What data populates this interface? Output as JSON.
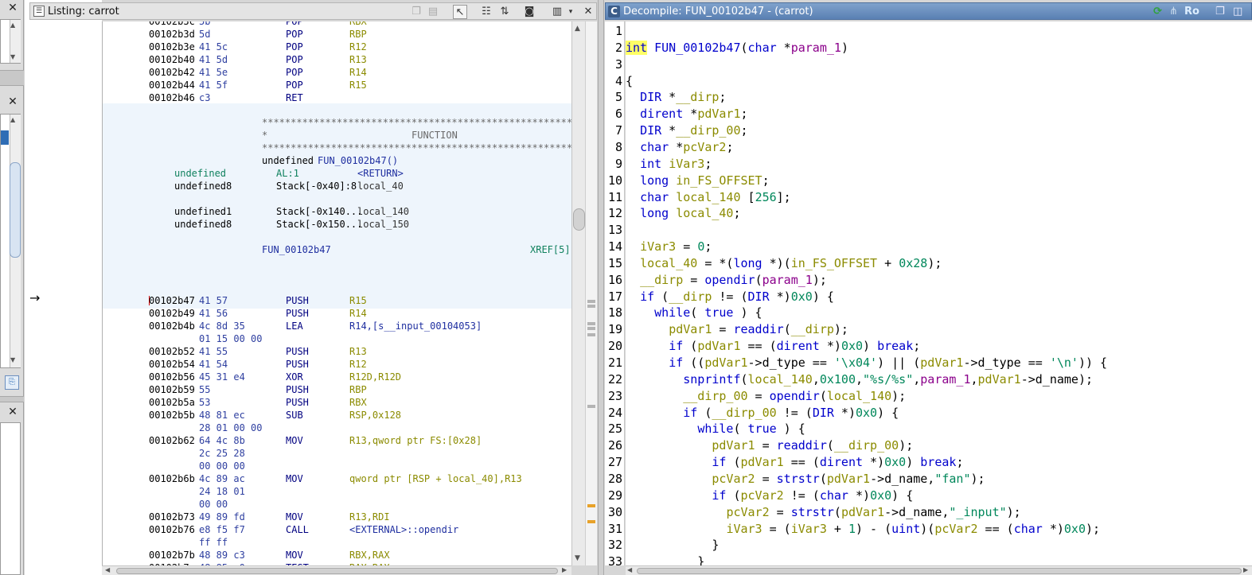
{
  "listing": {
    "title": "Listing:  carrot",
    "rows": [
      {
        "addr": "00102b3d",
        "bytes": "5d",
        "mnem": "POP",
        "oper": "RBP"
      },
      {
        "addr": "00102b3e",
        "bytes": "41 5c",
        "mnem": "POP",
        "oper": "R12"
      },
      {
        "addr": "00102b40",
        "bytes": "41 5d",
        "mnem": "POP",
        "oper": "R13"
      },
      {
        "addr": "00102b42",
        "bytes": "41 5e",
        "mnem": "POP",
        "oper": "R14"
      },
      {
        "addr": "00102b44",
        "bytes": "41 5f",
        "mnem": "POP",
        "oper": "R15"
      },
      {
        "addr": "00102b46",
        "bytes": "c3",
        "mnem": "RET",
        "oper": ""
      }
    ],
    "function_header": {
      "stars": "************************************************************",
      "star_mid": "*",
      "title": "FUNCTION",
      "signature_type": "undefined",
      "signature_name": "FUN_00102b47()",
      "vars": [
        {
          "type": "undefined",
          "loc": "AL:1",
          "name": "<RETURN>"
        },
        {
          "type": "undefined8",
          "loc": "Stack[-0x40]:8",
          "name": "local_40"
        },
        {
          "type": "undefined1",
          "loc": "Stack[-0x140...",
          "name": "local_140"
        },
        {
          "type": "undefined8",
          "loc": "Stack[-0x150...",
          "name": "local_150"
        }
      ],
      "label": "FUN_00102b47",
      "xref": "XREF[5]"
    },
    "code": [
      {
        "addr": "00102b47",
        "bytes": "41 57",
        "mnem": "PUSH",
        "oper": "R15"
      },
      {
        "addr": "00102b49",
        "bytes": "41 56",
        "mnem": "PUSH",
        "oper": "R14"
      },
      {
        "addr": "00102b4b",
        "bytes": "4c 8d 35",
        "mnem": "LEA",
        "oper": "R14,[s__input_00104053]"
      },
      {
        "addr": "",
        "bytes": "01 15 00 00",
        "mnem": "",
        "oper": ""
      },
      {
        "addr": "00102b52",
        "bytes": "41 55",
        "mnem": "PUSH",
        "oper": "R13"
      },
      {
        "addr": "00102b54",
        "bytes": "41 54",
        "mnem": "PUSH",
        "oper": "R12"
      },
      {
        "addr": "00102b56",
        "bytes": "45 31 e4",
        "mnem": "XOR",
        "oper": "R12D,R12D"
      },
      {
        "addr": "00102b59",
        "bytes": "55",
        "mnem": "PUSH",
        "oper": "RBP"
      },
      {
        "addr": "00102b5a",
        "bytes": "53",
        "mnem": "PUSH",
        "oper": "RBX"
      },
      {
        "addr": "00102b5b",
        "bytes": "48 81 ec",
        "mnem": "SUB",
        "oper": "RSP,0x128"
      },
      {
        "addr": "",
        "bytes": "28 01 00 00",
        "mnem": "",
        "oper": ""
      },
      {
        "addr": "00102b62",
        "bytes": "64 4c 8b",
        "mnem": "MOV",
        "oper": "R13,qword ptr FS:[0x28]"
      },
      {
        "addr": "",
        "bytes": "2c 25 28",
        "mnem": "",
        "oper": ""
      },
      {
        "addr": "",
        "bytes": "00 00 00",
        "mnem": "",
        "oper": ""
      },
      {
        "addr": "00102b6b",
        "bytes": "4c 89 ac",
        "mnem": "MOV",
        "oper": "qword ptr [RSP + local_40],R13"
      },
      {
        "addr": "",
        "bytes": "24 18 01",
        "mnem": "",
        "oper": ""
      },
      {
        "addr": "",
        "bytes": "00 00",
        "mnem": "",
        "oper": ""
      },
      {
        "addr": "00102b73",
        "bytes": "49 89 fd",
        "mnem": "MOV",
        "oper": "R13,RDI"
      },
      {
        "addr": "00102b76",
        "bytes": "e8 f5 f7",
        "mnem": "CALL",
        "oper": "<EXTERNAL>::opendir"
      },
      {
        "addr": "",
        "bytes": "ff ff",
        "mnem": "",
        "oper": ""
      },
      {
        "addr": "00102b7b",
        "bytes": "48 89 c3",
        "mnem": "MOV",
        "oper": "RBX,RAX"
      }
    ]
  },
  "decompile": {
    "title": "Decompile: FUN_00102b47 - (carrot)",
    "ro_label": "Ro",
    "lines": [
      "1",
      "2",
      "3",
      "4",
      "5",
      "6",
      "7",
      "8",
      "9",
      "10",
      "11",
      "12",
      "13",
      "14",
      "15",
      "16",
      "17",
      "18",
      "19",
      "20",
      "21",
      "22",
      "23",
      "24",
      "25",
      "26",
      "27",
      "28",
      "29",
      "30",
      "31",
      "32",
      "33"
    ],
    "code": [
      [],
      [
        [
          "type",
          "int"
        ],
        [
          "plain",
          " "
        ],
        [
          "fn",
          "FUN_00102b47"
        ],
        [
          "plain",
          "("
        ],
        [
          "type",
          "char"
        ],
        [
          "plain",
          " *"
        ],
        [
          "param",
          "param_1"
        ],
        [
          "plain",
          ")"
        ]
      ],
      [],
      [
        [
          "plain",
          "{"
        ]
      ],
      [
        [
          "plain",
          "  "
        ],
        [
          "type",
          "DIR"
        ],
        [
          "plain",
          " *"
        ],
        [
          "var",
          "__dirp"
        ],
        [
          "plain",
          ";"
        ]
      ],
      [
        [
          "plain",
          "  "
        ],
        [
          "type",
          "dirent"
        ],
        [
          "plain",
          " *"
        ],
        [
          "var",
          "pdVar1"
        ],
        [
          "plain",
          ";"
        ]
      ],
      [
        [
          "plain",
          "  "
        ],
        [
          "type",
          "DIR"
        ],
        [
          "plain",
          " *"
        ],
        [
          "var",
          "__dirp_00"
        ],
        [
          "plain",
          ";"
        ]
      ],
      [
        [
          "plain",
          "  "
        ],
        [
          "type",
          "char"
        ],
        [
          "plain",
          " *"
        ],
        [
          "var",
          "pcVar2"
        ],
        [
          "plain",
          ";"
        ]
      ],
      [
        [
          "plain",
          "  "
        ],
        [
          "type",
          "int"
        ],
        [
          "plain",
          " "
        ],
        [
          "var",
          "iVar3"
        ],
        [
          "plain",
          ";"
        ]
      ],
      [
        [
          "plain",
          "  "
        ],
        [
          "type",
          "long"
        ],
        [
          "plain",
          " "
        ],
        [
          "var",
          "in_FS_OFFSET"
        ],
        [
          "plain",
          ";"
        ]
      ],
      [
        [
          "plain",
          "  "
        ],
        [
          "type",
          "char"
        ],
        [
          "plain",
          " "
        ],
        [
          "var",
          "local_140"
        ],
        [
          "plain",
          " ["
        ],
        [
          "num",
          "256"
        ],
        [
          "plain",
          "];"
        ]
      ],
      [
        [
          "plain",
          "  "
        ],
        [
          "type",
          "long"
        ],
        [
          "plain",
          " "
        ],
        [
          "var",
          "local_40"
        ],
        [
          "plain",
          ";"
        ]
      ],
      [],
      [
        [
          "plain",
          "  "
        ],
        [
          "var",
          "iVar3"
        ],
        [
          "plain",
          " = "
        ],
        [
          "num",
          "0"
        ],
        [
          "plain",
          ";"
        ]
      ],
      [
        [
          "plain",
          "  "
        ],
        [
          "var",
          "local_40"
        ],
        [
          "plain",
          " = *("
        ],
        [
          "type",
          "long"
        ],
        [
          "plain",
          " *)("
        ],
        [
          "var",
          "in_FS_OFFSET"
        ],
        [
          "plain",
          " + "
        ],
        [
          "num",
          "0x28"
        ],
        [
          "plain",
          ");"
        ]
      ],
      [
        [
          "plain",
          "  "
        ],
        [
          "var",
          "__dirp"
        ],
        [
          "plain",
          " = "
        ],
        [
          "fn",
          "opendir"
        ],
        [
          "plain",
          "("
        ],
        [
          "param",
          "param_1"
        ],
        [
          "plain",
          ");"
        ]
      ],
      [
        [
          "plain",
          "  "
        ],
        [
          "kw",
          "if"
        ],
        [
          "plain",
          " ("
        ],
        [
          "var",
          "__dirp"
        ],
        [
          "plain",
          " != ("
        ],
        [
          "type",
          "DIR"
        ],
        [
          "plain",
          " *)"
        ],
        [
          "num",
          "0x0"
        ],
        [
          "plain",
          ") {"
        ]
      ],
      [
        [
          "plain",
          "    "
        ],
        [
          "kw",
          "while"
        ],
        [
          "plain",
          "( "
        ],
        [
          "kw",
          "true"
        ],
        [
          "plain",
          " ) {"
        ]
      ],
      [
        [
          "plain",
          "      "
        ],
        [
          "var",
          "pdVar1"
        ],
        [
          "plain",
          " = "
        ],
        [
          "fn",
          "readdir"
        ],
        [
          "plain",
          "("
        ],
        [
          "var",
          "__dirp"
        ],
        [
          "plain",
          ");"
        ]
      ],
      [
        [
          "plain",
          "      "
        ],
        [
          "kw",
          "if"
        ],
        [
          "plain",
          " ("
        ],
        [
          "var",
          "pdVar1"
        ],
        [
          "plain",
          " == ("
        ],
        [
          "type",
          "dirent"
        ],
        [
          "plain",
          " *)"
        ],
        [
          "num",
          "0x0"
        ],
        [
          "plain",
          ") "
        ],
        [
          "kw",
          "break"
        ],
        [
          "plain",
          ";"
        ]
      ],
      [
        [
          "plain",
          "      "
        ],
        [
          "kw",
          "if"
        ],
        [
          "plain",
          " (("
        ],
        [
          "var",
          "pdVar1"
        ],
        [
          "plain",
          "->d_type == "
        ],
        [
          "str",
          "'\\x04'"
        ],
        [
          "plain",
          ") || ("
        ],
        [
          "var",
          "pdVar1"
        ],
        [
          "plain",
          "->d_type == "
        ],
        [
          "str",
          "'\\n'"
        ],
        [
          "plain",
          ")) {"
        ]
      ],
      [
        [
          "plain",
          "        "
        ],
        [
          "fn",
          "snprintf"
        ],
        [
          "plain",
          "("
        ],
        [
          "var",
          "local_140"
        ],
        [
          "plain",
          ","
        ],
        [
          "num",
          "0x100"
        ],
        [
          "plain",
          ","
        ],
        [
          "str",
          "\"%s/%s\""
        ],
        [
          "plain",
          ","
        ],
        [
          "param",
          "param_1"
        ],
        [
          "plain",
          ","
        ],
        [
          "var",
          "pdVar1"
        ],
        [
          "plain",
          "->d_name);"
        ]
      ],
      [
        [
          "plain",
          "        "
        ],
        [
          "var",
          "__dirp_00"
        ],
        [
          "plain",
          " = "
        ],
        [
          "fn",
          "opendir"
        ],
        [
          "plain",
          "("
        ],
        [
          "var",
          "local_140"
        ],
        [
          "plain",
          ");"
        ]
      ],
      [
        [
          "plain",
          "        "
        ],
        [
          "kw",
          "if"
        ],
        [
          "plain",
          " ("
        ],
        [
          "var",
          "__dirp_00"
        ],
        [
          "plain",
          " != ("
        ],
        [
          "type",
          "DIR"
        ],
        [
          "plain",
          " *)"
        ],
        [
          "num",
          "0x0"
        ],
        [
          "plain",
          ") {"
        ]
      ],
      [
        [
          "plain",
          "          "
        ],
        [
          "kw",
          "while"
        ],
        [
          "plain",
          "( "
        ],
        [
          "kw",
          "true"
        ],
        [
          "plain",
          " ) {"
        ]
      ],
      [
        [
          "plain",
          "            "
        ],
        [
          "var",
          "pdVar1"
        ],
        [
          "plain",
          " = "
        ],
        [
          "fn",
          "readdir"
        ],
        [
          "plain",
          "("
        ],
        [
          "var",
          "__dirp_00"
        ],
        [
          "plain",
          ");"
        ]
      ],
      [
        [
          "plain",
          "            "
        ],
        [
          "kw",
          "if"
        ],
        [
          "plain",
          " ("
        ],
        [
          "var",
          "pdVar1"
        ],
        [
          "plain",
          " == ("
        ],
        [
          "type",
          "dirent"
        ],
        [
          "plain",
          " *)"
        ],
        [
          "num",
          "0x0"
        ],
        [
          "plain",
          ") "
        ],
        [
          "kw",
          "break"
        ],
        [
          "plain",
          ";"
        ]
      ],
      [
        [
          "plain",
          "            "
        ],
        [
          "var",
          "pcVar2"
        ],
        [
          "plain",
          " = "
        ],
        [
          "fn",
          "strstr"
        ],
        [
          "plain",
          "("
        ],
        [
          "var",
          "pdVar1"
        ],
        [
          "plain",
          "->d_name,"
        ],
        [
          "str",
          "\"fan\""
        ],
        [
          "plain",
          ");"
        ]
      ],
      [
        [
          "plain",
          "            "
        ],
        [
          "kw",
          "if"
        ],
        [
          "plain",
          " ("
        ],
        [
          "var",
          "pcVar2"
        ],
        [
          "plain",
          " != ("
        ],
        [
          "type",
          "char"
        ],
        [
          "plain",
          " *)"
        ],
        [
          "num",
          "0x0"
        ],
        [
          "plain",
          ") {"
        ]
      ],
      [
        [
          "plain",
          "              "
        ],
        [
          "var",
          "pcVar2"
        ],
        [
          "plain",
          " = "
        ],
        [
          "fn",
          "strstr"
        ],
        [
          "plain",
          "("
        ],
        [
          "var",
          "pdVar1"
        ],
        [
          "plain",
          "->d_name,"
        ],
        [
          "str",
          "\"_input\""
        ],
        [
          "plain",
          ");"
        ]
      ],
      [
        [
          "plain",
          "              "
        ],
        [
          "var",
          "iVar3"
        ],
        [
          "plain",
          " = ("
        ],
        [
          "var",
          "iVar3"
        ],
        [
          "plain",
          " + "
        ],
        [
          "num",
          "1"
        ],
        [
          "plain",
          ") - ("
        ],
        [
          "type",
          "uint"
        ],
        [
          "plain",
          ")("
        ],
        [
          "var",
          "pcVar2"
        ],
        [
          "plain",
          " == ("
        ],
        [
          "type",
          "char"
        ],
        [
          "plain",
          " *)"
        ],
        [
          "num",
          "0x0"
        ],
        [
          "plain",
          ");"
        ]
      ],
      [
        [
          "plain",
          "            }"
        ]
      ],
      [
        [
          "plain",
          "          }"
        ]
      ]
    ]
  },
  "icons": {
    "close": "close-icon",
    "listing": "listing-icon",
    "decompile": "decompile-c-icon",
    "refresh": "refresh-icon"
  },
  "colors": {
    "header_active": "#5a80b3",
    "function_bg": "#eef5fc",
    "highlight": "#ffff66"
  }
}
